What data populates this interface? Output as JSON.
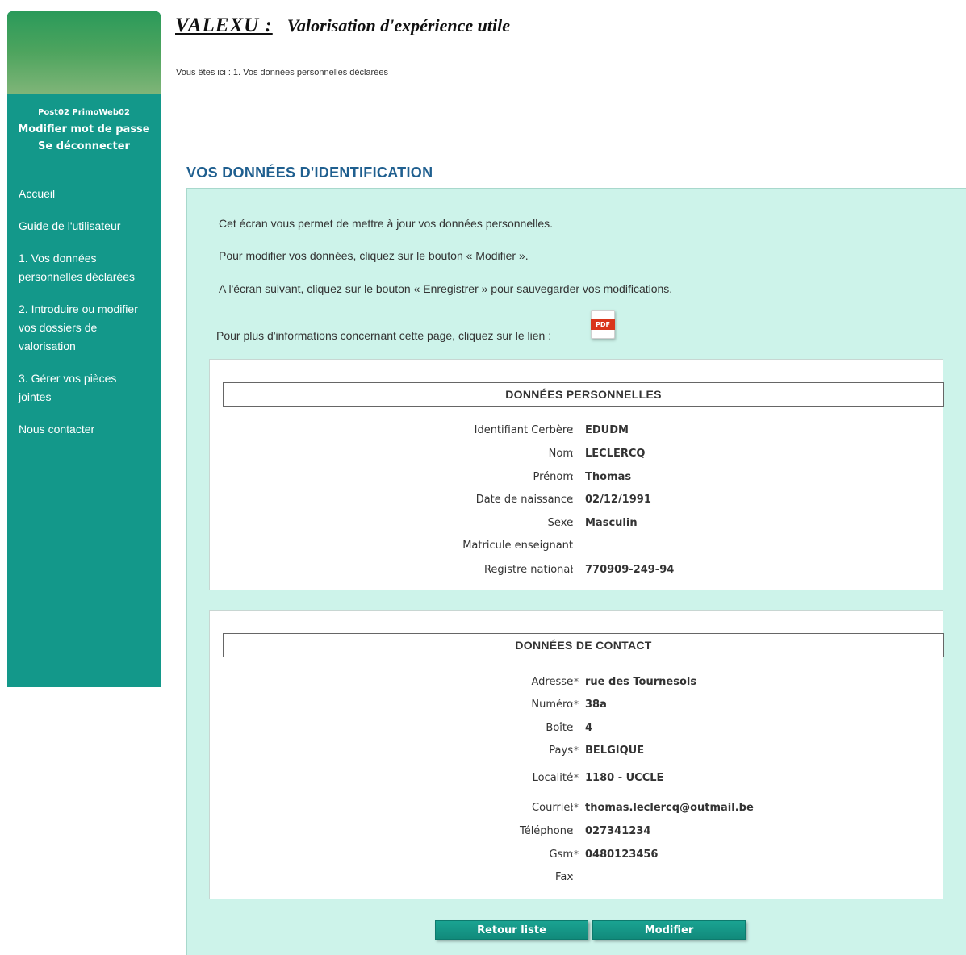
{
  "header": {
    "brand": "VALEXU :",
    "subtitle": "Valorisation d'expérience utile",
    "breadcrumb": "Vous êtes ici : 1. Vos données personnelles déclarées"
  },
  "sidebar": {
    "user_name": "Post02 PrimoWeb02",
    "change_password": "Modifier mot de passe",
    "logout": "Se déconnecter",
    "items": [
      {
        "label": "Accueil"
      },
      {
        "label": "Guide de l'utilisateur"
      },
      {
        "label": "1. Vos données personnelles déclarées"
      },
      {
        "label": "2. Introduire ou modifier vos dossiers de valorisation"
      },
      {
        "label": "3. Gérer vos pièces jointes"
      },
      {
        "label": "Nous contacter"
      }
    ]
  },
  "main": {
    "section_title": "VOS DONNÉES D'IDENTIFICATION",
    "intro": [
      "Cet écran vous permet de mettre à jour vos données personnelles.",
      "Pour modifier vos données, cliquez sur le bouton « Modifier ».",
      "A l'écran suivant, cliquez sur le bouton « Enregistrer » pour sauvegarder vos modifications.",
      "Pour plus d'informations concernant cette page, cliquez sur le lien :"
    ],
    "pdf_label": "PDF",
    "personal": {
      "title": "DONNÉES PERSONNELLES",
      "fields": [
        {
          "label": "Identifiant Cerbère",
          "sep": ":",
          "value": "EDUDM"
        },
        {
          "label": "Nom",
          "sep": ":",
          "value": "LECLERCQ"
        },
        {
          "label": "Prénom",
          "sep": ":",
          "value": "Thomas"
        },
        {
          "label": "Date de naissance",
          "sep": ":",
          "value": "02/12/1991"
        },
        {
          "label": "Sexe",
          "sep": ":",
          "value": "Masculin"
        },
        {
          "label": "Matricule enseignant",
          "sep": ":",
          "value": ""
        },
        {
          "label": "Registre national",
          "sep": ":",
          "value": "770909-249-94"
        }
      ]
    },
    "contact": {
      "title": "DONNÉES DE CONTACT",
      "fields": [
        {
          "label": "Adresse",
          "sep": ":*",
          "value": "rue des Tournesols"
        },
        {
          "label": "Numéro",
          "sep": ":*",
          "value": "38a"
        },
        {
          "label": "Boîte",
          "sep": ":",
          "value": "4"
        },
        {
          "label": "Pays",
          "sep": ":*",
          "value": "BELGIQUE"
        },
        {
          "label": "Localité",
          "sep": ":*",
          "value": " 1180 - UCCLE"
        },
        {
          "label": "Courriel",
          "sep": ":*",
          "value": "thomas.leclercq@outmail.be"
        },
        {
          "label": "Téléphone",
          "sep": ":",
          "value": "027341234"
        },
        {
          "label": "Gsm",
          "sep": ":*",
          "value": "0480123456"
        },
        {
          "label": "Fax",
          "sep": ":",
          "value": ""
        }
      ]
    },
    "buttons": {
      "back": "Retour liste",
      "edit": "Modifier"
    }
  }
}
